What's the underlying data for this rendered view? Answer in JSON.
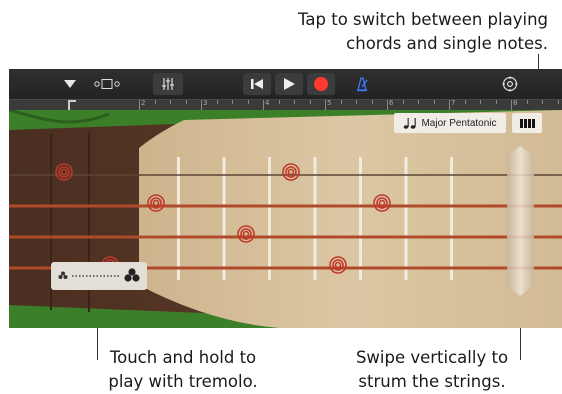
{
  "callouts": {
    "top_line1": "Tap to switch between playing",
    "top_line2": "chords and single notes.",
    "left_line1": "Touch and hold to",
    "left_line2": "play with tremolo.",
    "right_line1": "Swipe vertically to",
    "right_line2": "strum the strings."
  },
  "toolbar": {
    "icons": [
      "dropdown-icon",
      "view-toggle-icon",
      "mixer-icon",
      "rewind-icon",
      "play-icon",
      "record-icon",
      "metronome-icon",
      "settings-icon"
    ],
    "record_color": "#ff3b30",
    "metronome_color": "#3d7bff"
  },
  "ruler": {
    "marks": [
      "2",
      "3",
      "4",
      "5",
      "6",
      "7",
      "8"
    ]
  },
  "scale": {
    "icon": "music-notes-icon",
    "label": "Major Pentatonic"
  },
  "mode": {
    "icon": "chord-strips-icon"
  },
  "tremolo": {
    "icons": [
      "small-flower-icon",
      "large-flower-icon"
    ]
  },
  "instrument": {
    "strings": 4,
    "frets": 7,
    "note_markers": 7,
    "colors": {
      "body": "#d8c39f",
      "leaf": "#3e8a2c",
      "bridge": "#5a3a28",
      "string": "#b04a2a",
      "marker": "#c0392b"
    }
  }
}
